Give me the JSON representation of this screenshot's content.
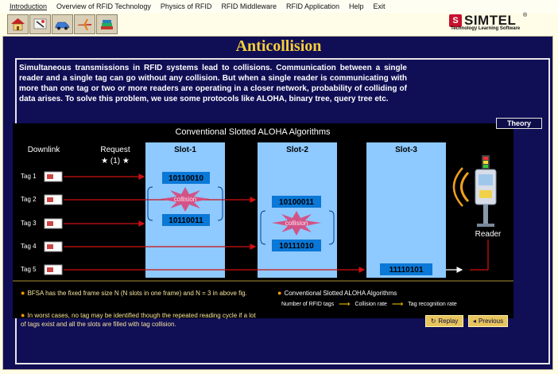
{
  "menu": [
    "Introduction",
    "Overview of RFID Technology",
    "Physics of RFID",
    "RFID Middleware",
    "RFID Application",
    "Help",
    "Exit"
  ],
  "toolbar_icons": [
    "home-icon",
    "tools-icon",
    "car-icon",
    "airplane-icon",
    "books-icon"
  ],
  "logo": {
    "brand": "SIMTEL",
    "registered": "®",
    "tagline": "Technology Learning Software"
  },
  "page": {
    "title": "Anticollision",
    "description": "Simultaneous transmissions in RFID systems lead to collisions. Communication between a single reader and a single tag can go without any collision. But when a single reader is communicating with more than one tag or two or more readers are operating in a closer network, probability of colliding of data arises. To solve this problem, we use some protocols like ALOHA, binary tree, query tree etc.",
    "theory_label": "Theory"
  },
  "diagram": {
    "heading": "Conventional Slotted ALOHA Algorithms",
    "downlink": "Downlink",
    "request": "Request",
    "request_marker": "★ (1) ★",
    "slots": [
      "Slot-1",
      "Slot-2",
      "Slot-3"
    ],
    "tags": [
      "Tag 1",
      "Tag 2",
      "Tag 3",
      "Tag 4",
      "Tag 5"
    ],
    "slot1_ids": [
      "10110010",
      "10110011"
    ],
    "slot2_ids": [
      "10100011",
      "10111010"
    ],
    "slot3_ids": [
      "11110101"
    ],
    "collision_label": "collision",
    "reader_label": "Reader"
  },
  "notes": {
    "note1": "BFSA has the fixed frame size N (N slots in one frame) and N = 3 in above fig.",
    "note2": "In worst cases, no tag may be identified though the repeated reading cycle if a lot of tags exist and all the slots are filled with tag collision.",
    "note3": "Conventional Slotted ALOHA Algorithms",
    "legend": [
      "Number of RFID tags",
      "Collision rate",
      "Tag recognition rate"
    ]
  },
  "buttons": {
    "replay": "Replay",
    "previous": "Previous"
  },
  "colors": {
    "stage": "#100e55",
    "title": "#f4ce3c",
    "slot_box": "#8ec9ff",
    "id_box": "#0a78d6",
    "collision_fill": "#d9477a",
    "arrow": "#d01010",
    "button": "#e7c45c"
  }
}
